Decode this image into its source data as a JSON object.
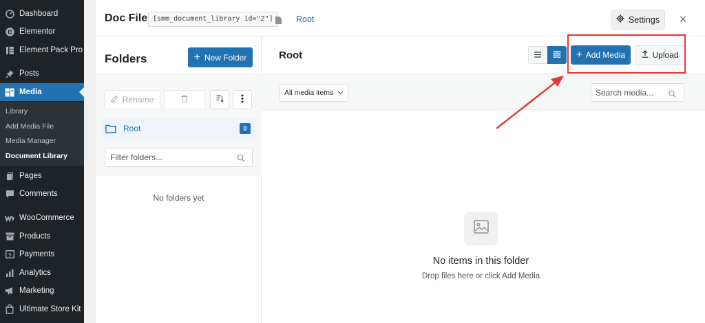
{
  "sidebar": {
    "items": [
      {
        "label": "Dashboard",
        "icon": "dashboard-icon"
      },
      {
        "label": "Elementor",
        "icon": "elementor-icon"
      },
      {
        "label": "Element Pack Pro",
        "icon": "element-pack-icon"
      },
      {
        "label": "Posts",
        "icon": "pin-icon"
      },
      {
        "label": "Media",
        "icon": "media-icon"
      },
      {
        "label": "Pages",
        "icon": "page-icon"
      },
      {
        "label": "Comments",
        "icon": "comment-icon"
      },
      {
        "label": "WooCommerce",
        "icon": "woocommerce-icon"
      },
      {
        "label": "Products",
        "icon": "archive-icon"
      },
      {
        "label": "Payments",
        "icon": "payments-icon"
      },
      {
        "label": "Analytics",
        "icon": "analytics-icon"
      },
      {
        "label": "Marketing",
        "icon": "megaphone-icon"
      },
      {
        "label": "Ultimate Store Kit",
        "icon": "bag-icon"
      }
    ],
    "media_submenu": [
      "Library",
      "Add Media File",
      "Media Manager",
      "Document Library"
    ],
    "active": "Media",
    "current_submenu": "Document Library"
  },
  "modal": {
    "title": "Doc File",
    "shortcode": "[smm_document_library id=\"2\"]",
    "breadcrumb": "Root",
    "settings_label": "Settings",
    "close_glyph": "×"
  },
  "folders": {
    "title": "Folders",
    "new_folder_label": "New Folder",
    "rename_label": "Rename",
    "root_label": "Root",
    "root_count": "0",
    "filter_placeholder": "Filter folders...",
    "empty_text": "No folders yet"
  },
  "main": {
    "title": "Root",
    "add_media_label": "Add Media",
    "upload_label": "Upload",
    "filter_select": "All media items",
    "search_placeholder": "Search media...",
    "empty_title": "No items in this folder",
    "empty_subtitle": "Drop files here or click Add Media"
  },
  "colors": {
    "accent": "#2271b1",
    "sidebar_bg": "#1d2327",
    "annotation": "#e53935"
  }
}
